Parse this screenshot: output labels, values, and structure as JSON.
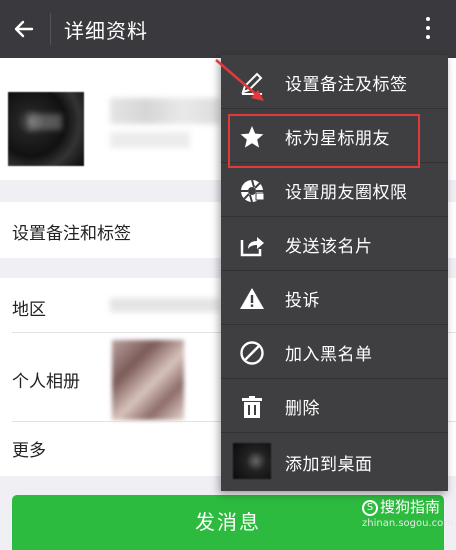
{
  "header": {
    "title": "详细资料",
    "back_icon": "arrow-left-icon",
    "more_icon": "more-vertical-icon"
  },
  "rows": {
    "remark_label": "设置备注和标签",
    "region_label": "地区",
    "album_label": "个人相册",
    "more_label": "更多"
  },
  "send_button": "发消息",
  "menu": {
    "items": [
      {
        "label": "设置备注及标签",
        "icon": "pencil-icon"
      },
      {
        "label": "标为星标朋友",
        "icon": "star-icon"
      },
      {
        "label": "设置朋友圈权限",
        "icon": "aperture-icon"
      },
      {
        "label": "发送该名片",
        "icon": "share-icon"
      },
      {
        "label": "投诉",
        "icon": "warning-icon"
      },
      {
        "label": "加入黑名单",
        "icon": "block-icon"
      },
      {
        "label": "删除",
        "icon": "trash-icon"
      },
      {
        "label": "添加到桌面",
        "icon": "thumbnail"
      }
    ]
  },
  "watermark": {
    "brand": "搜狗指南",
    "url": "zhinan.sogou.com"
  },
  "colors": {
    "titlebar": "#3a3a3e",
    "menu": "#3f3f42",
    "send_button": "#2dbb3f",
    "annotation": "#e03a3a"
  }
}
